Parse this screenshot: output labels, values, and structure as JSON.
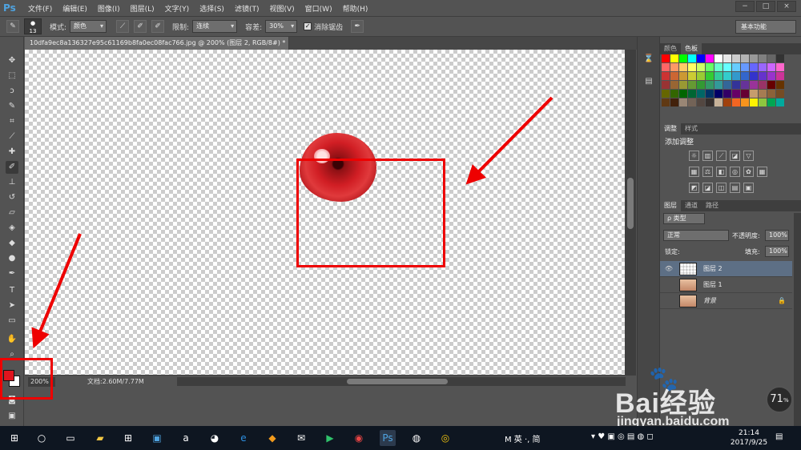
{
  "app": {
    "logo": "Ps",
    "menus": [
      "文件(F)",
      "编辑(E)",
      "图像(I)",
      "图层(L)",
      "文字(Y)",
      "选择(S)",
      "滤镜(T)",
      "视图(V)",
      "窗口(W)",
      "帮助(H)"
    ],
    "window_controls": [
      "−",
      "□",
      "×"
    ]
  },
  "options_bar": {
    "brush_size": "13",
    "mode_label": "模式:",
    "mode_value": "颜色",
    "limit_label": "限制:",
    "limit_value": "连续",
    "tolerance_label": "容差:",
    "tolerance_value": "30%",
    "antialias_label": "消除锯齿",
    "antialias_checked": "✓",
    "workspace": "基本功能"
  },
  "document": {
    "tab_title": "10dfa9ec8a136327e95c61169b8fa0ec08fac766.jpg @ 200% (图层 2, RGB/8#) *",
    "zoom": "200%",
    "doc_info": "文档:2.60M/7.77M"
  },
  "colors": {
    "foreground": "#e0141e",
    "background": "#ffffff",
    "annotation": "#ee0000"
  },
  "panels": {
    "swatch_tabs": [
      "颜色",
      "色板"
    ],
    "adjust_tabs": [
      "调整",
      "样式"
    ],
    "adjust_title": "添加调整",
    "layers_tabs": [
      "图层",
      "通道",
      "路径"
    ],
    "filter_kind": "ρ 类型",
    "blend_mode": "正常",
    "opacity_label": "不透明度:",
    "opacity_value": "100%",
    "lock_label": "锁定:",
    "fill_label": "填充:",
    "fill_value": "100%",
    "layers": [
      {
        "name": "图层 2",
        "visible": "👁",
        "selected": true
      },
      {
        "name": "图层 1",
        "visible": "",
        "selected": false
      },
      {
        "name": "背景",
        "visible": "",
        "selected": false
      }
    ]
  },
  "swatches": [
    "#ff0000",
    "#ffff00",
    "#00ff00",
    "#00ffff",
    "#0000ff",
    "#ff00ff",
    "#ffffff",
    "#e6e6e6",
    "#cccccc",
    "#b3b3b3",
    "#999999",
    "#808080",
    "#666666",
    "#333333",
    "#ff6666",
    "#ff9966",
    "#ffcc66",
    "#ffff66",
    "#ccff66",
    "#66ff66",
    "#66ffcc",
    "#66ffff",
    "#66ccff",
    "#6699ff",
    "#6666ff",
    "#9966ff",
    "#cc66ff",
    "#ff66cc",
    "#cc3333",
    "#cc6633",
    "#cc9933",
    "#cccc33",
    "#99cc33",
    "#33cc33",
    "#33cc99",
    "#33cccc",
    "#3399cc",
    "#3366cc",
    "#3333cc",
    "#6633cc",
    "#9933cc",
    "#cc3399",
    "#993333",
    "#996633",
    "#999933",
    "#669933",
    "#339933",
    "#339966",
    "#339999",
    "#336699",
    "#333399",
    "#663399",
    "#993399",
    "#993366",
    "#660000",
    "#663300",
    "#666600",
    "#336600",
    "#006600",
    "#006633",
    "#006666",
    "#003366",
    "#000066",
    "#330066",
    "#660066",
    "#660033",
    "#c69c6d",
    "#a67c52",
    "#8c6239",
    "#754c24",
    "#603913",
    "#42210b",
    "#998675",
    "#736357",
    "#534741",
    "#362f2d",
    "#c7b299",
    "#a0410d",
    "#f26522",
    "#f7941d",
    "#fff200",
    "#8dc63f",
    "#00a651",
    "#00a99d"
  ],
  "watermark": {
    "brand": "Bai经验",
    "url": "jingyan.baidu.com",
    "speed": "71",
    "speed_unit": "%"
  },
  "taskbar": {
    "ime": "M 英 ·, 简",
    "time": "21:14",
    "date": "2017/9/25"
  }
}
